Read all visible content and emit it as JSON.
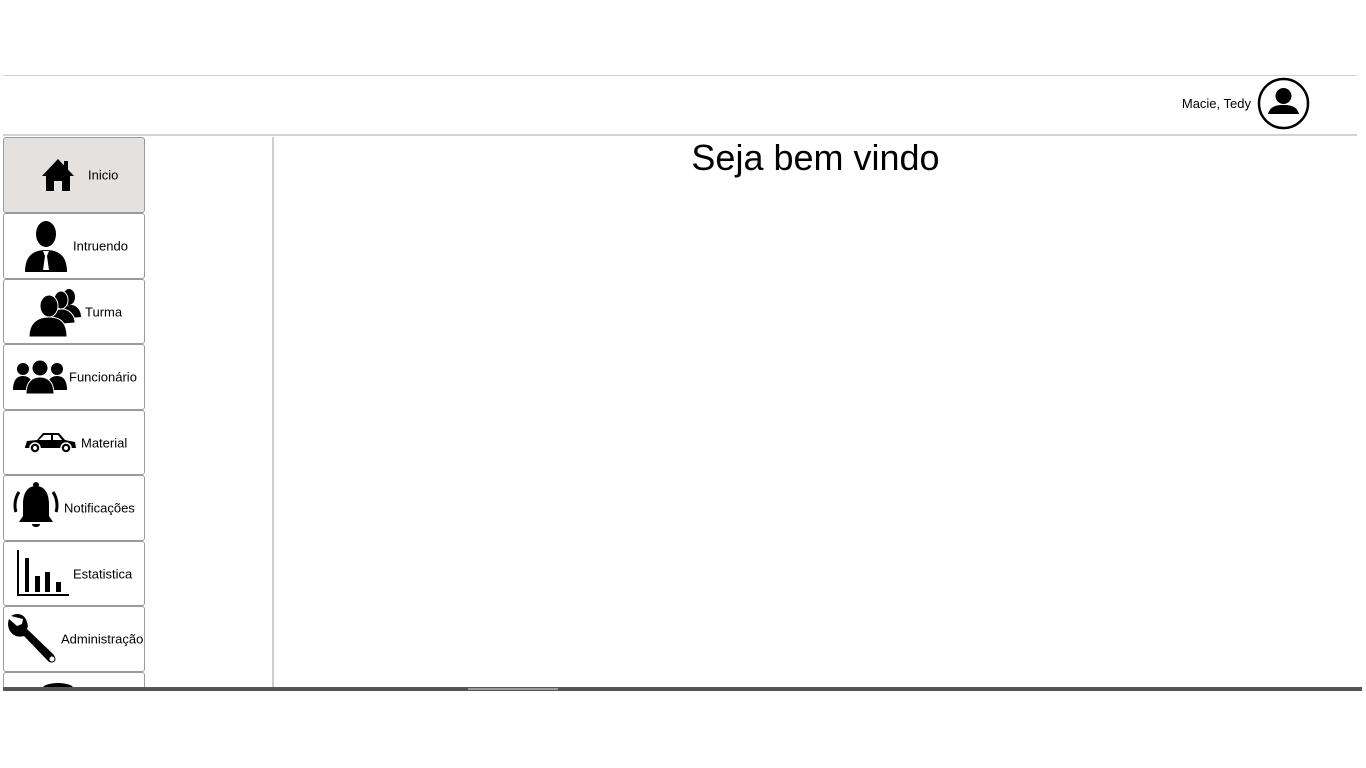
{
  "header": {
    "user_name": "Macie, Tedy",
    "avatar_icon": "user-circle-icon"
  },
  "sidebar": {
    "items": [
      {
        "label": "Inicio",
        "icon": "home-icon",
        "active": true
      },
      {
        "label": "Intruendo",
        "icon": "person-tie-icon",
        "active": false
      },
      {
        "label": "Turma",
        "icon": "group-icon",
        "active": false
      },
      {
        "label": "Funcionário",
        "icon": "staff-icon",
        "active": false
      },
      {
        "label": "Material",
        "icon": "car-icon",
        "active": false
      },
      {
        "label": "Notificações",
        "icon": "bell-icon",
        "active": false
      },
      {
        "label": "Estatistica",
        "icon": "bar-chart-icon",
        "active": false
      },
      {
        "label": "Administração",
        "icon": "wrench-icon",
        "active": false
      }
    ]
  },
  "main": {
    "welcome": "Seja bem vindo"
  },
  "colors": {
    "active_item_bg": "#e4e1de",
    "border": "#9a9a9a"
  }
}
